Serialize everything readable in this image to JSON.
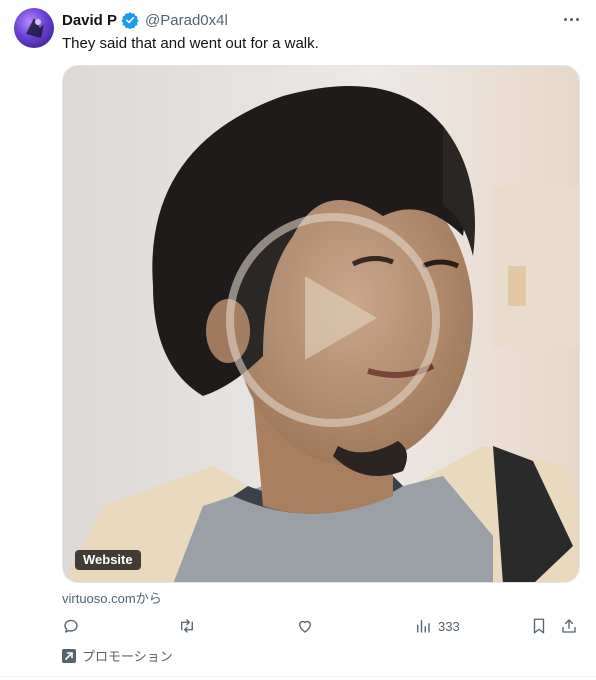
{
  "tweet": {
    "author_name": "David P",
    "author_handle": "@Parad0x4l",
    "text": "They said that and went out for a walk.",
    "media_badge": "Website",
    "source_text": "virtuoso.comから",
    "views_count": "333",
    "promo_label": "プロモーション"
  },
  "icons": {
    "verified": "verified-badge-icon",
    "more": "more-horizontal-icon",
    "reply": "reply-icon",
    "retweet": "retweet-icon",
    "like": "heart-icon",
    "views": "views-bar-chart-icon",
    "bookmark": "bookmark-icon",
    "share": "share-icon",
    "promo": "promoted-arrow-icon",
    "play": "play-icon"
  },
  "colors": {
    "text": "#0f1419",
    "secondary": "#536471",
    "verified": "#1d9bf0",
    "badge_bg": "#000000"
  }
}
